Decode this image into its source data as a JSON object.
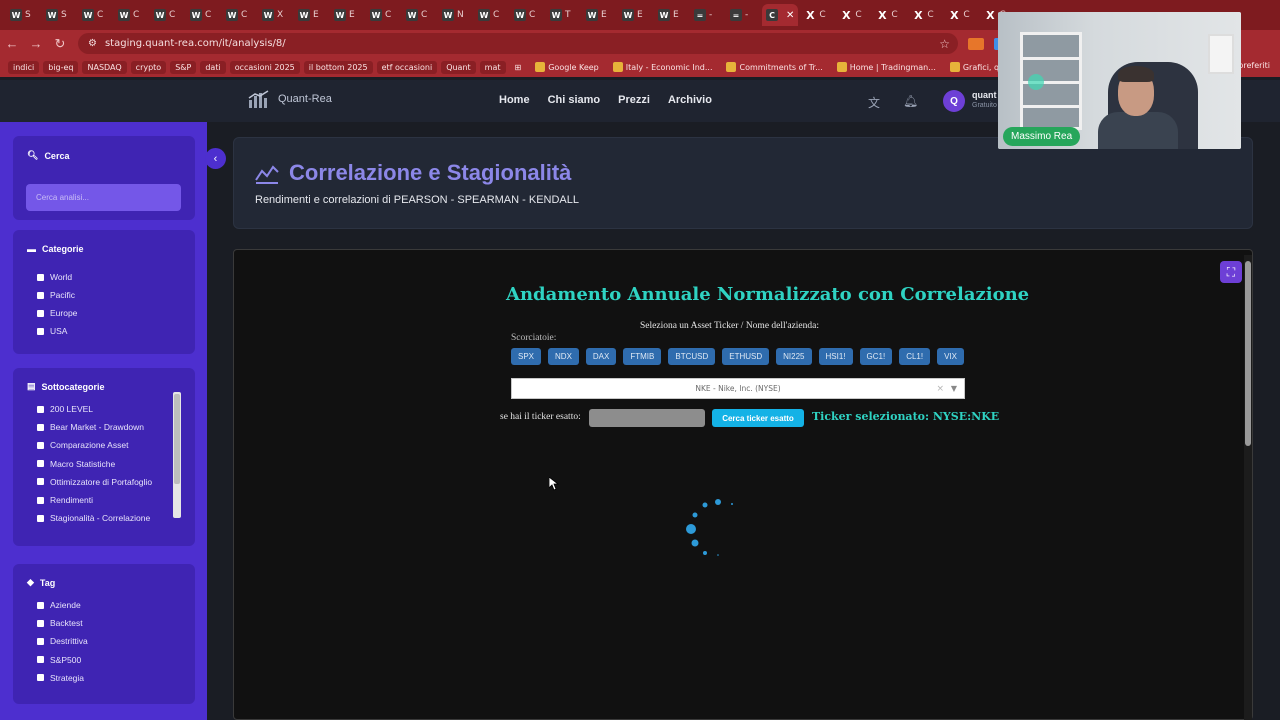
{
  "browser": {
    "tabs": [
      {
        "fav": "W",
        "label": "S"
      },
      {
        "fav": "W",
        "label": "S"
      },
      {
        "fav": "W",
        "label": "C"
      },
      {
        "fav": "W",
        "label": "C"
      },
      {
        "fav": "W",
        "label": "C"
      },
      {
        "fav": "W",
        "label": "C"
      },
      {
        "fav": "W",
        "label": "C"
      },
      {
        "fav": "W",
        "label": "X"
      },
      {
        "fav": "W",
        "label": "E"
      },
      {
        "fav": "W",
        "label": "E"
      },
      {
        "fav": "W",
        "label": "C"
      },
      {
        "fav": "W",
        "label": "C"
      },
      {
        "fav": "W",
        "label": "N"
      },
      {
        "fav": "W",
        "label": "C"
      },
      {
        "fav": "W",
        "label": "C"
      },
      {
        "fav": "W",
        "label": "T"
      },
      {
        "fav": "W",
        "label": "E"
      },
      {
        "fav": "W",
        "label": "E"
      },
      {
        "fav": "W",
        "label": "E"
      },
      {
        "fav": "=",
        "label": "-"
      },
      {
        "fav": "=",
        "label": "-"
      },
      {
        "fav": "C",
        "label": ""
      },
      {
        "fav": "X",
        "label": "C"
      },
      {
        "fav": "X",
        "label": "C"
      },
      {
        "fav": "X",
        "label": "C"
      },
      {
        "fav": "X",
        "label": "C"
      },
      {
        "fav": "X",
        "label": "C"
      },
      {
        "fav": "X",
        "label": "C"
      }
    ],
    "url": "staging.quant-rea.com/it/analysis/8/",
    "bookmarks": [
      "indici",
      "big-eq",
      "NASDAQ",
      "crypto",
      "S&P",
      "dati",
      "occasioni 2025",
      "il bottom 2025",
      "etf occasioni",
      "Quant",
      "mat"
    ],
    "bookmarks_plain": [
      "Google Keep",
      "Italy - Economic Ind...",
      "Commitments of Tr...",
      "Home | Tradingman...",
      "Grafici, quotazioni e...",
      "Grafi"
    ],
    "bookmarks_right": "preferiti"
  },
  "site": {
    "logo": "Quant-Rea",
    "nav": [
      "Home",
      "Chi siamo",
      "Prezzi",
      "Archivio"
    ],
    "avatar_initial": "Q",
    "user_name": "quant",
    "user_plan": "Gratuito"
  },
  "sidebar": {
    "search_title": "Cerca",
    "search_placeholder": "Cerca analisi...",
    "categories_title": "Categorie",
    "categories": [
      "World",
      "Pacific",
      "Europe",
      "USA"
    ],
    "subcategories_title": "Sottocategorie",
    "subcategories": [
      "200 LEVEL",
      "Bear Market - Drawdown",
      "Comparazione Asset",
      "Macro Statistiche",
      "Ottimizzatore di Portafoglio",
      "Rendimenti",
      "Stagionalità - Correlazione"
    ],
    "tags_title": "Tag",
    "tags": [
      "Aziende",
      "Backtest",
      "Destrittiva",
      "S&P500",
      "Strategia"
    ]
  },
  "page": {
    "title": "Correlazione e Stagionalità",
    "subtitle": "Rendimenti e correlazioni di PEARSON - SPEARMAN - KENDALL"
  },
  "dash": {
    "title": "Andamento Annuale Normalizzato con Correlazione",
    "select_label": "Seleziona un Asset Ticker / Nome dell'azienda:",
    "shortcuts_label": "Scorciatoie:",
    "shortcuts": [
      "SPX",
      "NDX",
      "DAX",
      "FTMIB",
      "BTCUSD",
      "ETHUSD",
      "NI225",
      "HSI1!",
      "GC1!",
      "CL1!",
      "VIX"
    ],
    "selected_asset": "NKE - Nike, Inc. (NYSE)",
    "exact_ticker_label": "se hai il ticker esatto:",
    "exact_ticker_value": "",
    "search_button": "Cerca ticker esatto",
    "selected_ticker": "Ticker selezionato: NYSE:NKE"
  },
  "webcam": {
    "name": "Massimo Rea"
  },
  "colors": {
    "brand_purple": "#4d2fcf",
    "accent_teal": "#2fd3c3",
    "button_blue": "#14b2e6",
    "chip_blue": "#2f6cae",
    "browser_red": "#a42a30"
  }
}
